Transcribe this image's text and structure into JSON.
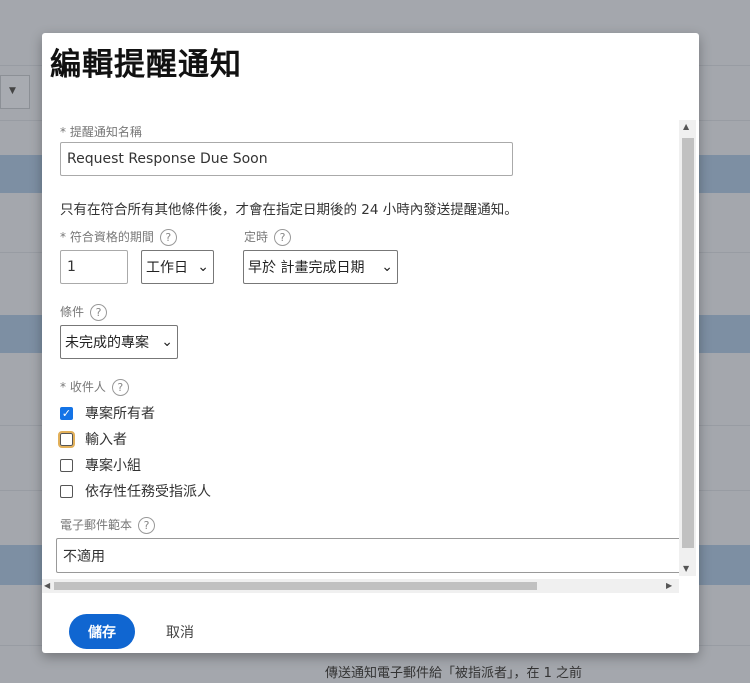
{
  "dialog": {
    "title": "編輯提醒通知",
    "name_label": "* 提醒通知名稱",
    "name_value": "Request Response Due Soon",
    "info_text": "只有在符合所有其他條件後，才會在指定日期後的 24 小時內發送提醒通知。",
    "period_label": "* 符合資格的期間",
    "period_value": "1",
    "period_unit": "工作日",
    "timing_label": "定時",
    "timing_value": "早於 計畫完成日期",
    "condition_label": "條件",
    "condition_value": "未完成的專案",
    "recipients_label": "* 收件人",
    "recipients": [
      {
        "label": "專案所有者",
        "checked": true
      },
      {
        "label": "輸入者",
        "checked": false
      },
      {
        "label": "專案小組",
        "checked": false
      },
      {
        "label": "依存性任務受指派人",
        "checked": false
      }
    ],
    "template_label": "電子郵件範本",
    "template_value": "不適用",
    "help": "?",
    "save_label": "儲存",
    "cancel_label": "取消"
  },
  "background": {
    "footer_text": "傳送通知電子郵件給「被指派者」，在 1 之前"
  }
}
